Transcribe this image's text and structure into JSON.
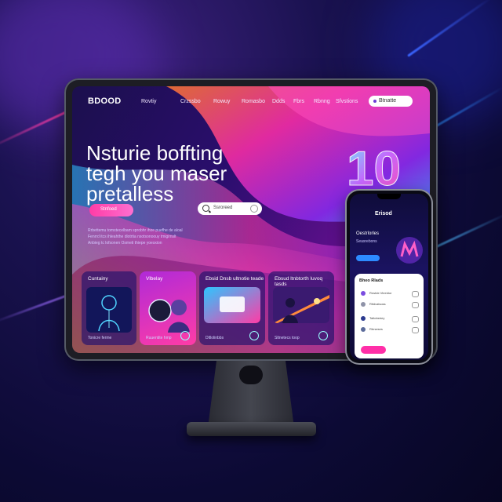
{
  "nav": {
    "logo": "BDOOD",
    "links": [
      "Rovtiy",
      "Crzssbo",
      "Rowuy",
      "Romasbo",
      "Ddds",
      "Fbrs",
      "Rbnng",
      "Sfvstions"
    ],
    "cta": "Btnatte"
  },
  "hero": {
    "title_line1": "Nsturie boffting",
    "title_line2": "tegh you maser",
    "title_line3": "pretalless",
    "button": "Stnfoed",
    "search_value": "Ssroreed",
    "sub1": "Rrbettemu tomstecelbam sprobhr ihoe puefhe de aloal",
    "sub2": "Fenrrd itcs ihleahthe dlotrtia nsotsonoouy tmigimslt",
    "sub3": "Anbieg tc lofsonen Osmeti thiepe yoesxion"
  },
  "cards": [
    {
      "title": "Cuntainy",
      "meta": "Tonicre ferme"
    },
    {
      "title": "Vlbelay",
      "meta": "Ruuentite hmp"
    },
    {
      "title": "Ebsid Dnsb ultnotie teade",
      "meta": "Dltlolinbbs"
    },
    {
      "title": "Ebsud ltnbtorth luvoq tasds",
      "meta": "Sltnetecs toop"
    }
  ],
  "numeral": "10",
  "phone": {
    "logo": "Erisod",
    "title": "Oestrlorles",
    "subtitle": "Seasrebons",
    "panel_title": "Bheo Rlads",
    "rows": [
      {
        "label": "Rnstde Vieeldor",
        "color": "#7b4de0"
      },
      {
        "label": "Rtldvatsoss",
        "color": "#8f93a8"
      },
      {
        "label": "Taltobstrey",
        "color": "#2b3a8f"
      },
      {
        "label": "Rbrseses",
        "color": "#5b6b9a"
      }
    ]
  },
  "colors": {
    "accent_pink": "#ff3ca6",
    "accent_blue": "#2d8bff",
    "accent_purple": "#6b3bd6"
  }
}
